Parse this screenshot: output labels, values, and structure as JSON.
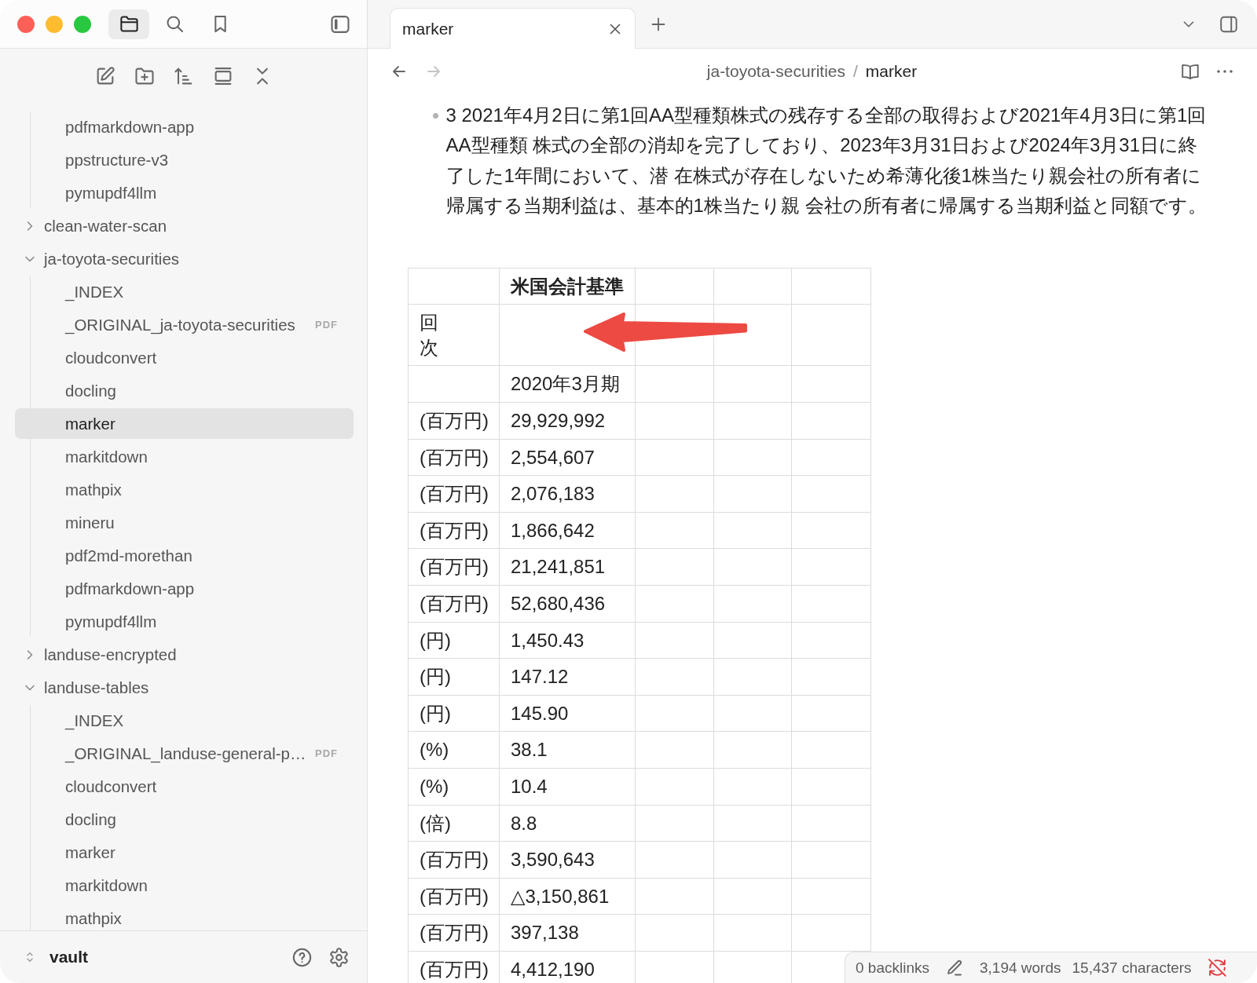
{
  "sidebar": {
    "tabs": [
      {
        "kind": "files",
        "selected": true
      },
      {
        "kind": "search",
        "selected": false
      },
      {
        "kind": "bookmarks",
        "selected": false
      }
    ],
    "tree": [
      {
        "kind": "continued",
        "children": [
          {
            "label": "pdfmarkdown-app",
            "selected": false
          },
          {
            "label": "ppstructure-v3",
            "selected": false
          },
          {
            "label": "pymupdf4llm",
            "selected": false
          }
        ]
      },
      {
        "kind": "folder",
        "label": "clean-water-scan",
        "expanded": false,
        "selected": false
      },
      {
        "kind": "folder",
        "label": "ja-toyota-securities",
        "expanded": true,
        "selected": false,
        "children": [
          {
            "label": "_INDEX",
            "selected": false
          },
          {
            "label": "_ORIGINAL_ja-toyota-securities",
            "badge": "PDF",
            "selected": false
          },
          {
            "label": "cloudconvert",
            "selected": false
          },
          {
            "label": "docling",
            "selected": false
          },
          {
            "label": "marker",
            "selected": true
          },
          {
            "label": "markitdown",
            "selected": false
          },
          {
            "label": "mathpix",
            "selected": false
          },
          {
            "label": "mineru",
            "selected": false
          },
          {
            "label": "pdf2md-morethan",
            "selected": false
          },
          {
            "label": "pdfmarkdown-app",
            "selected": false
          },
          {
            "label": "pymupdf4llm",
            "selected": false
          }
        ]
      },
      {
        "kind": "folder",
        "label": "landuse-encrypted",
        "expanded": false,
        "selected": false
      },
      {
        "kind": "folder",
        "label": "landuse-tables",
        "expanded": true,
        "selected": false,
        "children": [
          {
            "label": "_INDEX",
            "selected": false
          },
          {
            "label": "_ORIGINAL_landuse-general-p…",
            "badge": "PDF",
            "selected": false
          },
          {
            "label": "cloudconvert",
            "selected": false
          },
          {
            "label": "docling",
            "selected": false
          },
          {
            "label": "marker",
            "selected": false
          },
          {
            "label": "markitdown",
            "selected": false
          },
          {
            "label": "mathpix",
            "selected": false
          }
        ]
      }
    ],
    "vault": "vault"
  },
  "tabs": [
    {
      "title": "marker",
      "selected": true
    }
  ],
  "nav": [
    {
      "kind": "back",
      "disabled": false
    },
    {
      "kind": "forward",
      "disabled": true
    }
  ],
  "breadcrumb": {
    "parts": [
      "ja-toyota-securities",
      "marker"
    ],
    "separator": "/"
  },
  "content": {
    "list_items": [
      "3 2021年4月2日に第1回AA型種類株式の残存する全部の取得および2021年4月3日に第1回AA型種類 株式の全部の消却を完了しており、2023年3月31日および2024年3月31日に終了した1年間において、潜 在株式が存在しないため希薄化後1株当たり親会社の所有者に帰属する当期利益は、基本的1株当たり親 会社の所有者に帰属する当期利益と同額です。"
    ],
    "table": {
      "header": {
        "column_2": "米国会計基準"
      },
      "rows": [
        {
          "kind": "vertical_label",
          "column_1": "回次"
        },
        {
          "kind": "data",
          "column_2": "2020年3月期"
        },
        {
          "kind": "data",
          "column_1": "(百万円)",
          "column_2": "29,929,992"
        },
        {
          "kind": "data",
          "column_1": "(百万円)",
          "column_2": "2,554,607"
        },
        {
          "kind": "data",
          "column_1": "(百万円)",
          "column_2": "2,076,183"
        },
        {
          "kind": "data",
          "column_1": "(百万円)",
          "column_2": "1,866,642"
        },
        {
          "kind": "data",
          "column_1": "(百万円)",
          "column_2": "21,241,851"
        },
        {
          "kind": "data",
          "column_1": "(百万円)",
          "column_2": "52,680,436"
        },
        {
          "kind": "data",
          "column_1": "(円)",
          "column_2": "1,450.43"
        },
        {
          "kind": "data",
          "column_1": "(円)",
          "column_2": "147.12"
        },
        {
          "kind": "data",
          "column_1": "(円)",
          "column_2": "145.90"
        },
        {
          "kind": "data",
          "column_1": "(%)",
          "column_2": "38.1"
        },
        {
          "kind": "data",
          "column_1": "(%)",
          "column_2": "10.4"
        },
        {
          "kind": "data",
          "column_1": "(倍)",
          "column_2": "8.8"
        },
        {
          "kind": "data",
          "column_1": "(百万円)",
          "column_2": "3,590,643"
        },
        {
          "kind": "data",
          "column_1": "(百万円)",
          "column_2": "△3,150,861"
        },
        {
          "kind": "data",
          "column_1": "(百万円)",
          "column_2": "397,138"
        },
        {
          "kind": "data",
          "column_1": "(百万円)",
          "column_2": "4,412,190"
        }
      ]
    }
  },
  "status_bar": {
    "backlinks": "0 backlinks",
    "words": "3,194 words",
    "characters": "15,437 characters"
  }
}
